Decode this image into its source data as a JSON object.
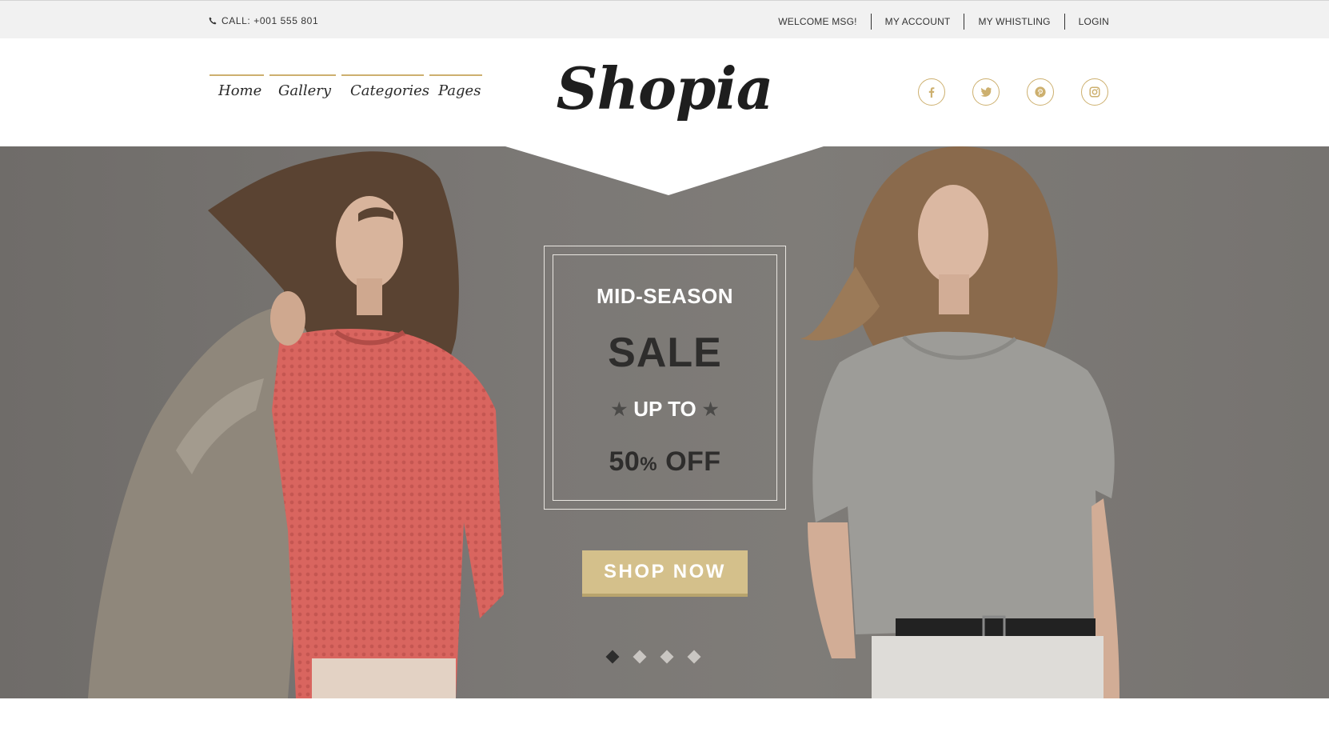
{
  "topbar": {
    "call_label": "CALL: +001 555 801",
    "links": [
      "WELCOME MSG!",
      "MY ACCOUNT",
      "MY WHISTLING",
      "LOGIN"
    ]
  },
  "header": {
    "nav": [
      "Home",
      "Gallery",
      "Categories",
      "Pages"
    ],
    "logo": "Shopia",
    "social_icons": [
      "facebook-icon",
      "twitter-icon",
      "pinterest-icon",
      "instagram-icon"
    ]
  },
  "hero": {
    "headline_top": "MID-SEASON",
    "headline_main": "SALE",
    "headline_sub": "UP TO",
    "discount_number": "50",
    "discount_percent": "%",
    "discount_word": "OFF",
    "cta_label": "SHOP NOW",
    "slides_count": 4,
    "active_slide": 1
  },
  "colors": {
    "accent_gold": "#cdb06f",
    "button_gold": "#d4c08b",
    "topbar_bg": "#f1f1f1",
    "hero_bg": "#7b7875"
  }
}
